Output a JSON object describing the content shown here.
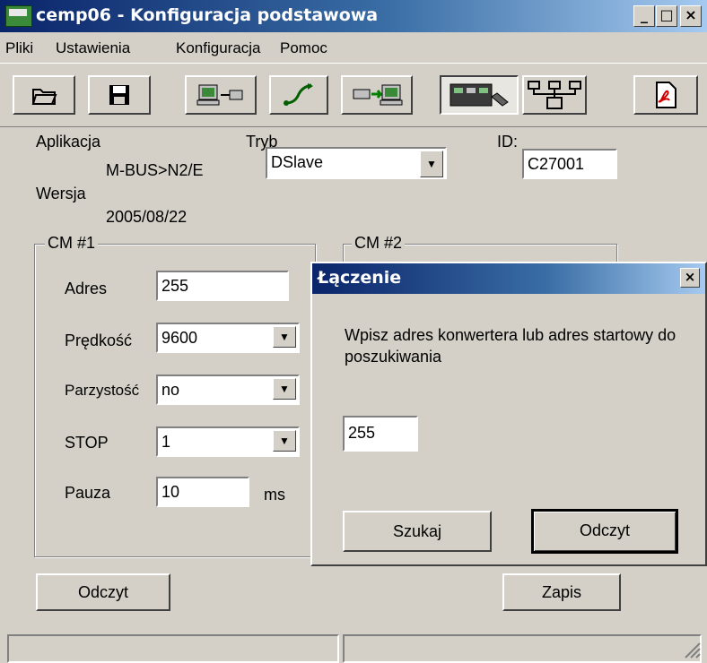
{
  "window": {
    "title": "cemp06 - Konfiguracja podstawowa",
    "minimize_glyph": "_",
    "maximize_glyph": "□",
    "close_glyph": "×"
  },
  "menu": [
    {
      "label": "Pliki"
    },
    {
      "label": "Ustawienia"
    },
    {
      "label": "Konfiguracja"
    },
    {
      "label": "Pomoc"
    }
  ],
  "toolbar": {
    "buttons": [
      {
        "name": "open-folder-icon"
      },
      {
        "name": "save-disk-icon"
      },
      {
        "name": "computer-connect-icon"
      },
      {
        "name": "arrow-connect-icon"
      },
      {
        "name": "transfer-to-computer-icon"
      },
      {
        "name": "device-config-icon",
        "pressed": true
      },
      {
        "name": "network-topology-icon"
      },
      {
        "name": "pdf-document-icon"
      }
    ]
  },
  "info": {
    "aplikacja_label": "Aplikacja",
    "aplikacja_value": "M-BUS>N2/E",
    "wersja_label": "Wersja",
    "wersja_value": "2005/08/22",
    "tryb_label": "Tryb",
    "tryb_value": "DSlave",
    "id_label": "ID:",
    "id_value": "C27001"
  },
  "cm1": {
    "title": "CM #1",
    "adres_label": "Adres",
    "adres_value": "255",
    "predkosc_label": "Prędkość",
    "predkosc_value": "9600",
    "parzystosc_label": "Parzystość",
    "parzystosc_value": "no",
    "stop_label": "STOP",
    "stop_value": "1",
    "pauza_label": "Pauza",
    "pauza_value": "10",
    "pauza_unit": "ms"
  },
  "cm2": {
    "title": "CM #2"
  },
  "buttons": {
    "odczyt": "Odczyt",
    "zapis": "Zapis"
  },
  "dialog": {
    "title": "Łączenie",
    "message": "Wpisz adres konwertera lub adres startowy do poszukiwania",
    "address_value": "255",
    "szukaj_label": "Szukaj",
    "odczyt_label": "Odczyt",
    "close_glyph": "×"
  }
}
